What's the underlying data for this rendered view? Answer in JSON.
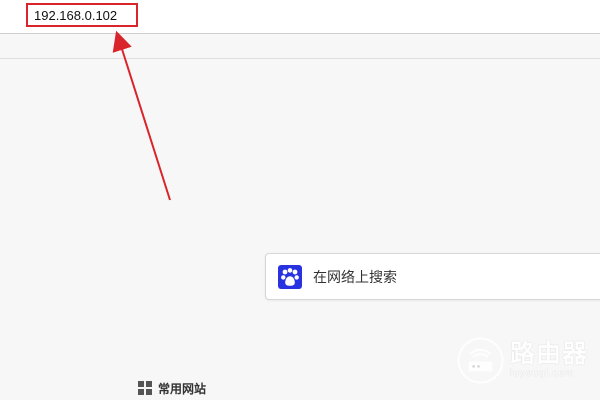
{
  "browser": {
    "address_value": "192.168.0.102"
  },
  "search": {
    "placeholder": "在网络上搜索",
    "icon": "baidu-paw-icon"
  },
  "common_sites": {
    "label": "常用网站",
    "icon": "grid-icon"
  },
  "watermark": {
    "title": "路由器",
    "subtitle": "luyouqi.com"
  },
  "colors": {
    "highlight": "#d9242b",
    "background": "#f7f7f7",
    "search_border": "#d6d6d6",
    "baidu_blue": "#2932e1"
  }
}
